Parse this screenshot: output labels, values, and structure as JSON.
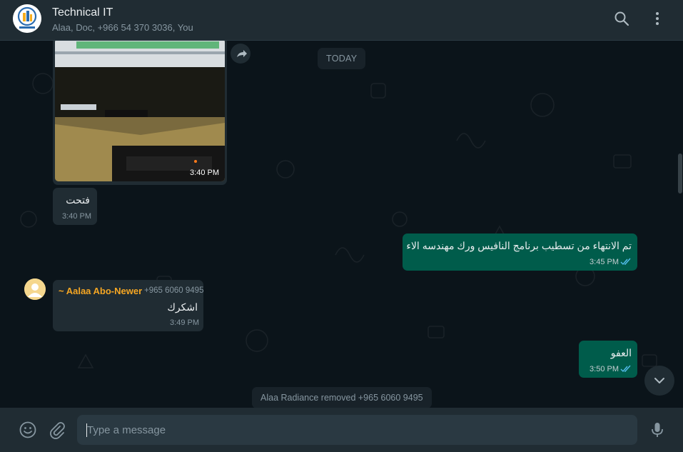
{
  "header": {
    "title": "Technical IT",
    "participants": "Alaa, Doc, +966 54 370 3036, You",
    "search_icon": "search-icon",
    "menu_icon": "more-vertical-icon"
  },
  "chat": {
    "date_chip": "TODAY",
    "messages": [
      {
        "type": "image",
        "direction": "in",
        "time": "3:40 PM"
      },
      {
        "type": "text",
        "direction": "in",
        "text": "فتحت",
        "time": "3:40 PM"
      },
      {
        "type": "text",
        "direction": "out",
        "text": "تم الانتهاء من تسطيب برنامج النافيس ورك مهندسه الاء",
        "time": "3:45 PM",
        "status": "read"
      },
      {
        "type": "text",
        "direction": "in",
        "sender": "~ Aalaa Abo-Newer",
        "phone": "+965 6060 9495",
        "text": "اشكرك",
        "time": "3:49 PM"
      },
      {
        "type": "text",
        "direction": "out",
        "text": "العفو",
        "time": "3:50 PM",
        "status": "read"
      }
    ],
    "system_message": "Alaa Radiance removed +965 6060 9495"
  },
  "composer": {
    "placeholder": "Type a message",
    "value": ""
  },
  "colors": {
    "header_bg": "#202c33",
    "chat_bg": "#0b141a",
    "incoming_bubble": "#202c33",
    "outgoing_bubble": "#005c4b",
    "sender_name": "#f5a623",
    "read_ticks": "#53bdeb"
  }
}
